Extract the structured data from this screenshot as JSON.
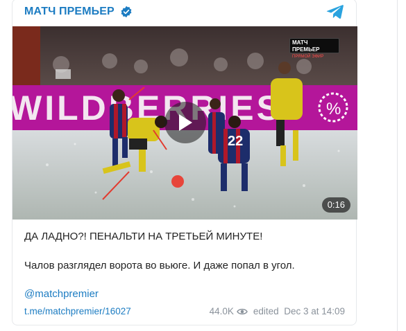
{
  "channel": {
    "name": "МАТЧ ПРЕМЬЕР",
    "verified": true
  },
  "icons": {
    "verified": "verified-badge-icon",
    "telegram": "telegram-icon",
    "play": "play-icon",
    "views": "eye-icon"
  },
  "video": {
    "duration": "0:16",
    "broadcast_badge": {
      "line1": "МАТЧ ПРЕМЬЕР",
      "line2": "ПРЯМОЙ ЭФИР"
    },
    "ad_board_text": "WILDBERRIES",
    "shirt_number": "22"
  },
  "post": {
    "title": "ДА ЛАДНО?! ПЕНАЛЬТИ НА ТРЕТЬЕЙ МИНУТЕ!",
    "body": "Чалов разглядел ворота во вьюге. И даже попал в угол.",
    "mention": "@matchpremier",
    "link": "t.me/matchpremier/16027",
    "views": "44.0K",
    "edited": "edited  Dec 3 at 14:09"
  },
  "colors": {
    "link": "#1c7cc2",
    "accent_telegram": "#2aa3df",
    "ad_board": "#b4169a"
  }
}
